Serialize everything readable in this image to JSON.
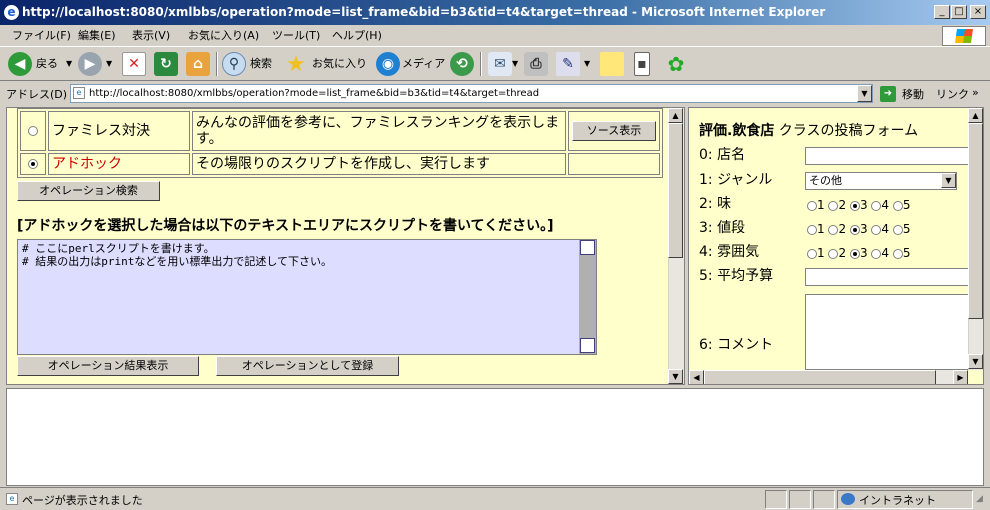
{
  "window": {
    "title": "http://localhost:8080/xmlbbs/operation?mode=list_frame&bid=b3&tid=t4&target=thread - Microsoft Internet Explorer",
    "minimize": "_",
    "maximize": "□",
    "close": "×"
  },
  "menu": [
    "ファイル(F)",
    "編集(E)",
    "表示(V)",
    "お気に入り(A)",
    "ツール(T)",
    "ヘルプ(H)"
  ],
  "toolbar": {
    "back": "戻る",
    "search": "検索",
    "favorites": "お気に入り",
    "media": "メディア"
  },
  "address": {
    "label": "アドレス(D)",
    "url": "http://localhost:8080/xmlbbs/operation?mode=list_frame&bid=b3&tid=t4&target=thread",
    "go": "移動",
    "links": "リンク"
  },
  "left": {
    "rows": [
      {
        "name": "ファミレス対決",
        "desc": "みんなの評価を参考に、ファミレスランキングを表示します。",
        "action": "ソース表示",
        "selected": false,
        "name_color": "#000000"
      },
      {
        "name": "アドホック",
        "desc": "その場限りのスクリプトを作成し、実行します",
        "action": "",
        "selected": true,
        "name_color": "#cc0000"
      }
    ],
    "search_button": "オペレーション検索",
    "instruction": "[アドホックを選択した場合は以下のテキストエリアにスクリプトを書いてください。]",
    "script_lines": [
      "# ここにperlスクリプトを書けます。",
      "# 結果の出力はprintなどを用い標準出力で記述して下さい。"
    ],
    "result_button": "オペレーション結果表示",
    "register_button": "オペレーションとして登録"
  },
  "right": {
    "title_bold": "評価.飲食店",
    "title_rest": " クラスの投稿フォーム",
    "fields": [
      {
        "num": "0:",
        "label": "店名",
        "type": "text"
      },
      {
        "num": "1:",
        "label": "ジャンル",
        "type": "select",
        "value": "その他"
      },
      {
        "num": "2:",
        "label": "味",
        "type": "radio",
        "selected": 3
      },
      {
        "num": "3:",
        "label": "値段",
        "type": "radio",
        "selected": 3
      },
      {
        "num": "4:",
        "label": "雰囲気",
        "type": "radio",
        "selected": 3
      },
      {
        "num": "5:",
        "label": "平均予算",
        "type": "text"
      },
      {
        "num": "6:",
        "label": "コメント",
        "type": "textarea"
      }
    ],
    "radio_options": [
      "1",
      "2",
      "3",
      "4",
      "5"
    ]
  },
  "status": {
    "text": "ページが表示されました",
    "zone": "イントラネット"
  },
  "colors": {
    "frame_bg": "#ffffcc",
    "textarea_bg": "#ddddff",
    "title_start": "#0a246a"
  }
}
